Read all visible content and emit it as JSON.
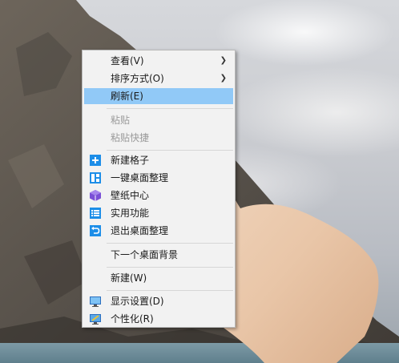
{
  "context_menu": {
    "items": [
      {
        "label": "查看(V)",
        "submenu": true,
        "state": "normal"
      },
      {
        "label": "排序方式(O)",
        "submenu": true,
        "state": "normal"
      },
      {
        "label": "刷新(E)",
        "submenu": false,
        "state": "highlighted"
      },
      {
        "label": "粘贴",
        "submenu": false,
        "state": "disabled"
      },
      {
        "label": "粘贴快捷",
        "submenu": false,
        "state": "disabled"
      },
      {
        "label": "新建格子",
        "icon": "plus-square-icon",
        "state": "normal"
      },
      {
        "label": "一键桌面整理",
        "icon": "layout-grid-icon",
        "state": "normal"
      },
      {
        "label": "壁纸中心",
        "icon": "cube-icon",
        "state": "normal"
      },
      {
        "label": "实用功能",
        "icon": "list-icon",
        "state": "normal"
      },
      {
        "label": "退出桌面整理",
        "icon": "exit-arrow-icon",
        "state": "normal"
      },
      {
        "label": "下一个桌面背景",
        "state": "normal"
      },
      {
        "label": "新建(W)",
        "state": "normal"
      },
      {
        "label": "显示设置(D)",
        "icon": "display-icon",
        "state": "normal"
      },
      {
        "label": "个性化(R)",
        "icon": "personalize-icon",
        "state": "normal"
      }
    ]
  },
  "colors": {
    "menu_background": "#f2f2f2",
    "highlight": "#91c9f7",
    "icon_blue": "#1d8ee8",
    "icon_purple": "#7a4fd6",
    "disabled_text": "#9a9a9a"
  }
}
